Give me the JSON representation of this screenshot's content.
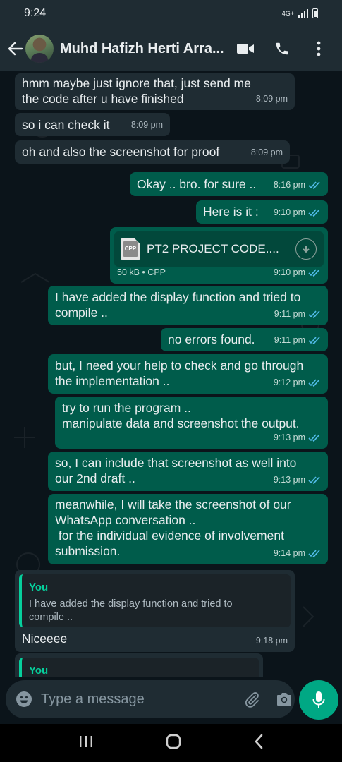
{
  "status_bar": {
    "time": "9:24",
    "network": "4G+"
  },
  "header": {
    "contact_name": "Muhd Hafizh Herti Arra..."
  },
  "messages": [
    {
      "dir": "in",
      "text": "hmm maybe just ignore that, just send me\nthe code after u have finished",
      "time": "8:09 pm"
    },
    {
      "dir": "in",
      "text": "so i can check it",
      "time": "8:09 pm"
    },
    {
      "dir": "in",
      "text": "oh and also the screenshot for proof",
      "time": "8:09 pm"
    },
    {
      "dir": "out",
      "text": "Okay .. bro. for sure ..",
      "time": "8:16 pm"
    },
    {
      "dir": "out",
      "text": "Here is it :",
      "time": "9:10 pm"
    },
    {
      "dir": "out",
      "type": "document",
      "file_name": "PT2 PROJECT CODE....",
      "file_ext": "CPP",
      "meta": "50 kB • CPP",
      "time": "9:10 pm"
    },
    {
      "dir": "out",
      "text": "I have added the display function and tried to\ncompile ..",
      "time": "9:11 pm"
    },
    {
      "dir": "out",
      "text": "no errors found.",
      "time": "9:11 pm"
    },
    {
      "dir": "out",
      "text": "but, I need your help to check and go through\nthe implementation ..",
      "time": "9:12 pm"
    },
    {
      "dir": "out",
      "text": "try to run the program ..\nmanipulate data and screenshot the output.",
      "time": "9:13 pm"
    },
    {
      "dir": "out",
      "text": "so, I can include that screenshot as well into\nour 2nd draft ..",
      "time": "9:13 pm"
    },
    {
      "dir": "out",
      "text": "meanwhile, I will take the screenshot of our\nWhatsApp conversation ..\n for the individual evidence of involvement\nsubmission.",
      "time": "9:14 pm"
    },
    {
      "dir": "in",
      "type": "reply",
      "quote_author": "You",
      "quote_text": "I have added the display function and tried to\ncompile ..",
      "text": "Niceeee",
      "time": "9:18 pm"
    },
    {
      "dir": "in",
      "type": "reply",
      "quote_author": "You"
    }
  ],
  "input": {
    "placeholder": "Type a message"
  },
  "colors": {
    "accent": "#00a884",
    "outgoing_bubble": "#005c4b",
    "incoming_bubble": "#1f2c33",
    "read_ticks": "#53bdeb"
  }
}
